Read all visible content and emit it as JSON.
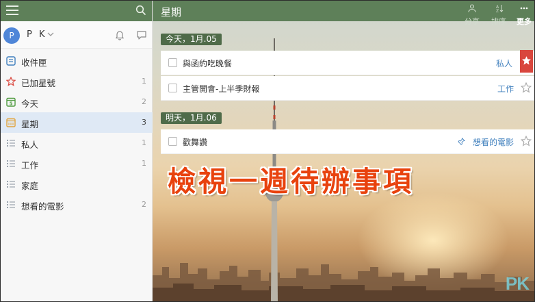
{
  "sidebar": {
    "user": {
      "initial": "P",
      "name": "P K"
    },
    "items": [
      {
        "label": "收件匣",
        "count": "",
        "icon": "inbox-icon"
      },
      {
        "label": "已加星號",
        "count": "1",
        "icon": "star-outline-icon"
      },
      {
        "label": "今天",
        "count": "2",
        "icon": "today-icon"
      },
      {
        "label": "星期",
        "count": "3",
        "icon": "week-icon"
      },
      {
        "label": "私人",
        "count": "1",
        "icon": "list-icon"
      },
      {
        "label": "工作",
        "count": "1",
        "icon": "list-icon"
      },
      {
        "label": "家庭",
        "count": "",
        "icon": "list-icon"
      },
      {
        "label": "想看的電影",
        "count": "2",
        "icon": "list-icon"
      }
    ]
  },
  "header": {
    "title": "星期",
    "actions": {
      "share": "分享",
      "sort": "排序",
      "more": "更多"
    }
  },
  "sections": [
    {
      "label": "今天，1月.05",
      "tasks": [
        {
          "text": "與函約吃晚餐",
          "tag": "私人",
          "starred": true
        },
        {
          "text": "主管開會-上半季財報",
          "tag": "工作",
          "starred": false
        }
      ]
    },
    {
      "label": "明天，1月.06",
      "tasks": [
        {
          "text": "歡舞讚",
          "tag": "想看的電影",
          "starred": false
        }
      ]
    }
  ],
  "caption": "檢視一週待辦事項",
  "watermark": "PK",
  "colors": {
    "header": "#5e8059",
    "section": "#4f6b49",
    "accent": "#d9463d",
    "tag": "#3f7fbd",
    "caption": "#e8420e"
  }
}
